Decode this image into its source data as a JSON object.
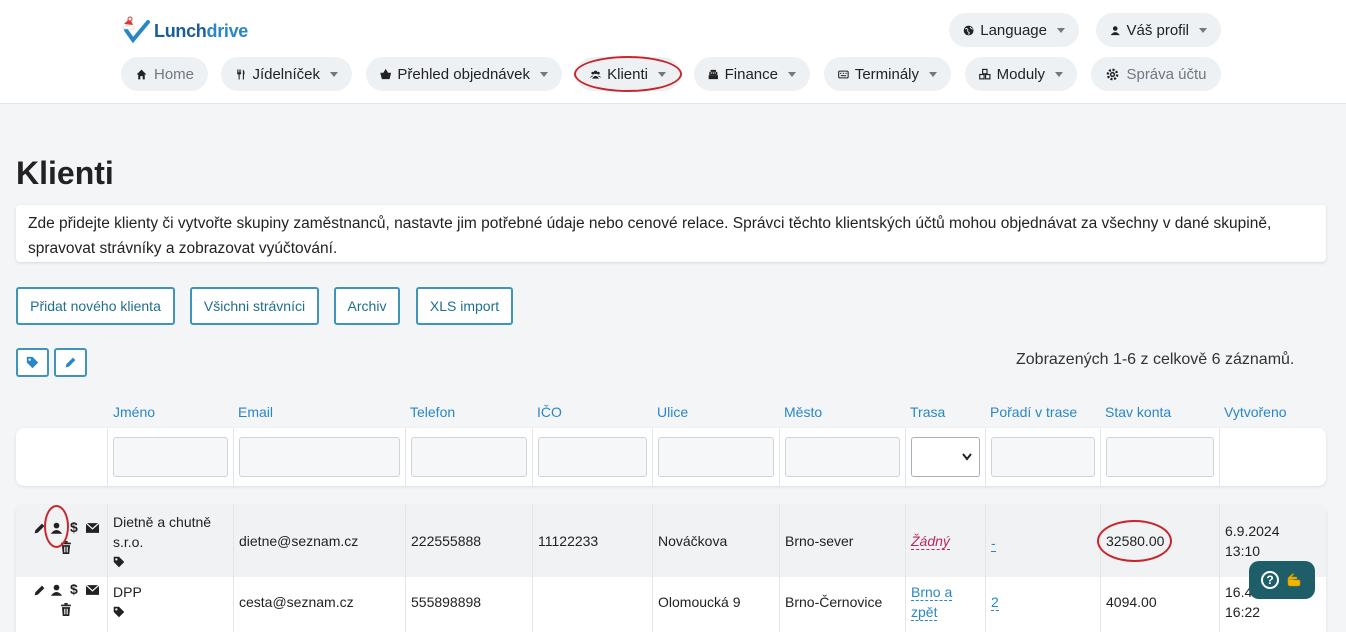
{
  "brand": {
    "name_lunch": "Lunch",
    "name_drive": "drive"
  },
  "top_nav": {
    "language": "Language",
    "profile": "Váš profil"
  },
  "nav": [
    {
      "label": "Home"
    },
    {
      "label": "Jídelníček"
    },
    {
      "label": "Přehled objednávek"
    },
    {
      "label": "Klienti"
    },
    {
      "label": "Finance"
    },
    {
      "label": "Terminály"
    },
    {
      "label": "Moduly"
    },
    {
      "label": "Správa účtu"
    }
  ],
  "page": {
    "title": "Klienti",
    "info": "Zde přidejte klienty či vytvořte skupiny zaměstnanců, nastavte jim potřebné údaje nebo cenové relace. Správci těchto klientských účtů mohou objednávat za všechny v dané skupině, spravovat strávníky a zobrazovat vyúčtování."
  },
  "actions": {
    "add_client": "Přidat nového klienta",
    "all_diners": "Všichni strávníci",
    "archive": "Archiv",
    "xls_import": "XLS import"
  },
  "records_info": "Zobrazených 1-6 z celkově 6 záznamů.",
  "columns": [
    "Jméno",
    "Email",
    "Telefon",
    "IČO",
    "Ulice",
    "Město",
    "Trasa",
    "Pořadí v trase",
    "Stav konta",
    "Vytvořeno"
  ],
  "rows": [
    {
      "name_line1": "Dietně a chutně",
      "name_line2": "s.r.o.",
      "email": "dietne@seznam.cz",
      "phone": "222555888",
      "ico": "11122233",
      "street": "Nováčkova",
      "city": "Brno-sever",
      "route": "Žádný",
      "order": "-",
      "balance": "32580.00",
      "created_date": "6.9.2024",
      "created_time": "13:10"
    },
    {
      "name_line1": "DPP",
      "name_line2": "",
      "email": "cesta@seznam.cz",
      "phone": "555898898",
      "ico": "",
      "street": "Olomoucká 9",
      "city": "Brno-Černovice",
      "route_line1": "Brno a",
      "route_line2": "zpět",
      "order": "2",
      "balance": "4094.00",
      "created_date": "16.4.",
      "created_time": "16:22"
    }
  ],
  "colors": {
    "accent": "#2a87c7",
    "button_border": "#3f95b9",
    "highlight": "#c8262d",
    "help_bg": "#1d5e68"
  }
}
